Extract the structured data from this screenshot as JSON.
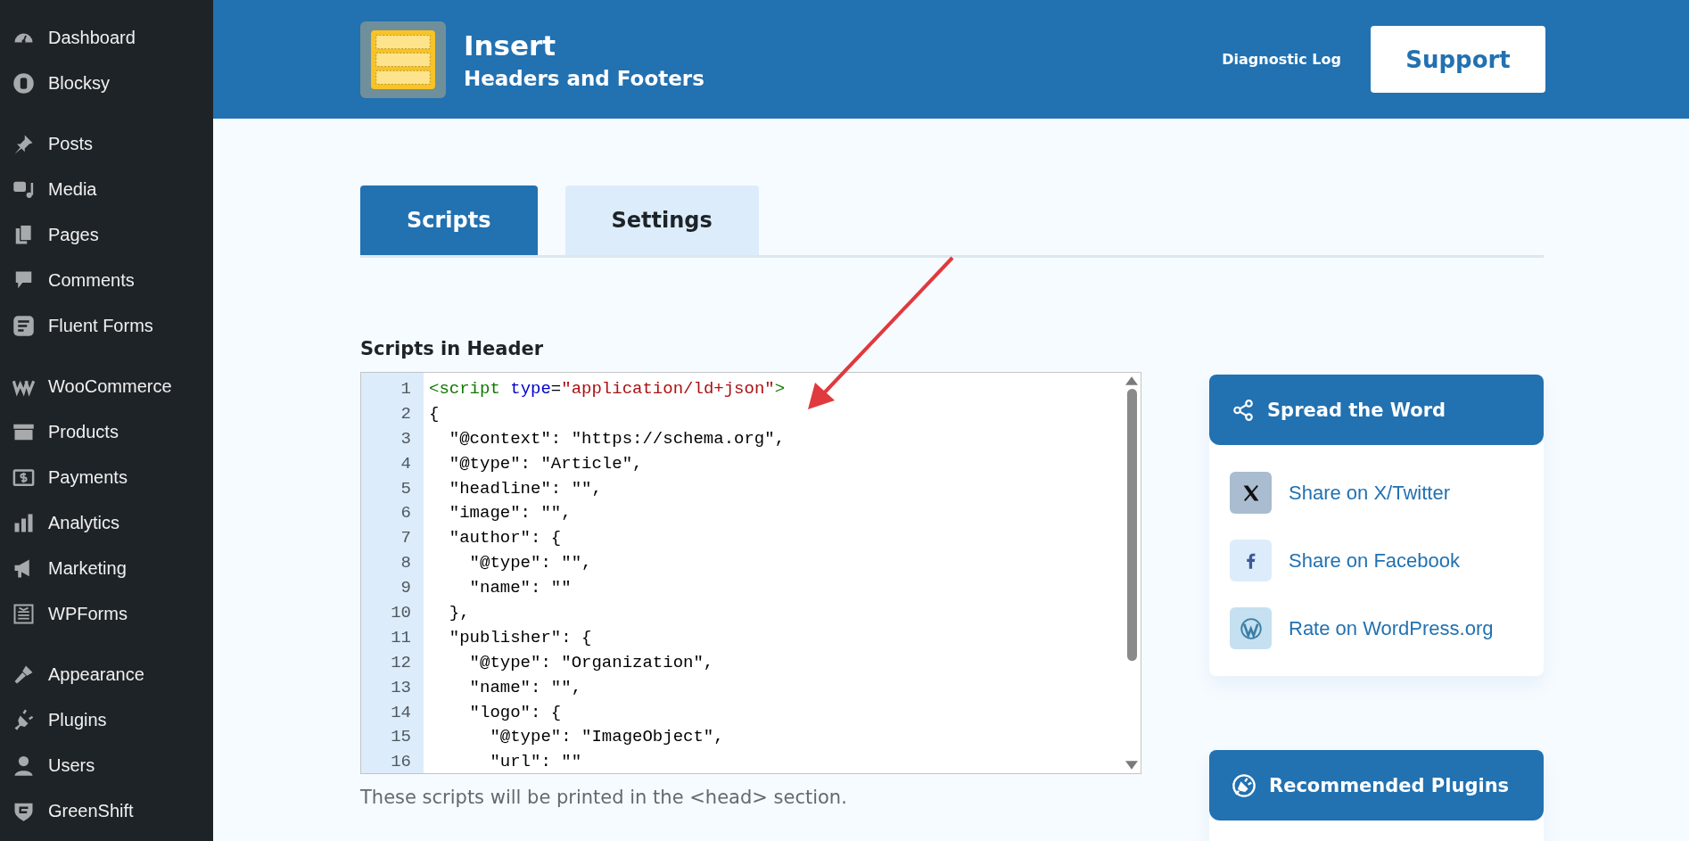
{
  "sidebar": {
    "groups": [
      {
        "items": [
          {
            "label": "Dashboard"
          },
          {
            "label": "Blocksy"
          }
        ]
      },
      {
        "items": [
          {
            "label": "Posts"
          },
          {
            "label": "Media"
          },
          {
            "label": "Pages"
          },
          {
            "label": "Comments"
          },
          {
            "label": "Fluent Forms"
          }
        ]
      },
      {
        "items": [
          {
            "label": "WooCommerce"
          },
          {
            "label": "Products"
          },
          {
            "label": "Payments"
          },
          {
            "label": "Analytics"
          },
          {
            "label": "Marketing"
          },
          {
            "label": "WPForms"
          }
        ]
      },
      {
        "items": [
          {
            "label": "Appearance"
          },
          {
            "label": "Plugins"
          },
          {
            "label": "Users"
          },
          {
            "label": "GreenShift"
          }
        ]
      }
    ]
  },
  "header": {
    "title": "Insert",
    "subtitle": "Headers and Footers",
    "diagnostic": {
      "text": "Diagnostic",
      "link": "Log"
    },
    "support_button": "Support"
  },
  "tabs": [
    {
      "label": "Scripts",
      "selected": true
    },
    {
      "label": "Settings",
      "selected": false
    }
  ],
  "section": {
    "heading": "Scripts in Header",
    "description": "These scripts will be printed in the <head> section.",
    "code_lines": [
      {
        "number": "1",
        "segments": [
          {
            "text": "<script",
            "kind": "tag"
          },
          {
            "text": " type",
            "kind": "attr"
          },
          {
            "text": "=",
            "kind": "plain"
          },
          {
            "text": "\"application/ld+json\"",
            "kind": "string"
          },
          {
            "text": ">",
            "kind": "tag"
          }
        ]
      },
      {
        "number": "2",
        "segments": [
          {
            "text": "{",
            "kind": "plain"
          }
        ]
      },
      {
        "number": "3",
        "segments": [
          {
            "text": "  \"@context\": \"https://schema.org\",",
            "kind": "plain"
          }
        ]
      },
      {
        "number": "4",
        "segments": [
          {
            "text": "  \"@type\": \"Article\",",
            "kind": "plain"
          }
        ]
      },
      {
        "number": "5",
        "segments": [
          {
            "text": "  \"headline\": \"\",",
            "kind": "plain"
          }
        ]
      },
      {
        "number": "6",
        "segments": [
          {
            "text": "  \"image\": \"\",",
            "kind": "plain"
          }
        ]
      },
      {
        "number": "7",
        "segments": [
          {
            "text": "  \"author\": {",
            "kind": "plain"
          }
        ]
      },
      {
        "number": "8",
        "segments": [
          {
            "text": "    \"@type\": \"\",",
            "kind": "plain"
          }
        ]
      },
      {
        "number": "9",
        "segments": [
          {
            "text": "    \"name\": \"\"",
            "kind": "plain"
          }
        ]
      },
      {
        "number": "10",
        "segments": [
          {
            "text": "  },",
            "kind": "plain"
          }
        ]
      },
      {
        "number": "11",
        "segments": [
          {
            "text": "  \"publisher\": {",
            "kind": "plain"
          }
        ]
      },
      {
        "number": "12",
        "segments": [
          {
            "text": "    \"@type\": \"Organization\",",
            "kind": "plain"
          }
        ]
      },
      {
        "number": "13",
        "segments": [
          {
            "text": "    \"name\": \"\",",
            "kind": "plain"
          }
        ]
      },
      {
        "number": "14",
        "segments": [
          {
            "text": "    \"logo\": {",
            "kind": "plain"
          }
        ]
      },
      {
        "number": "15",
        "segments": [
          {
            "text": "      \"@type\": \"ImageObject\",",
            "kind": "plain"
          }
        ]
      },
      {
        "number": "16",
        "segments": [
          {
            "text": "      \"url\": \"\"",
            "kind": "plain"
          }
        ]
      }
    ]
  },
  "spread_the_word": {
    "title": "Spread the Word",
    "links": [
      {
        "label": "Share on X/Twitter",
        "kind": "x"
      },
      {
        "label": "Share on Facebook",
        "kind": "facebook"
      },
      {
        "label": "Rate on WordPress.org",
        "kind": "wordpress"
      }
    ]
  },
  "recommended_plugins": {
    "title": "Recommended Plugins"
  }
}
